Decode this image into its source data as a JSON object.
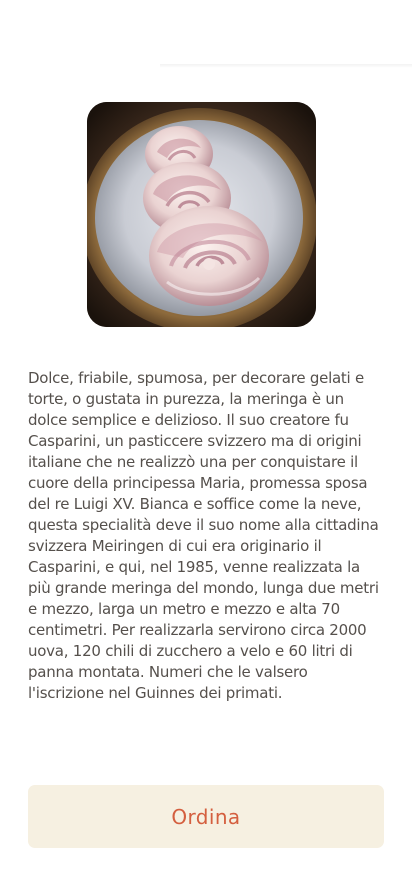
{
  "product": {
    "image_icon": "meringue-photo",
    "description": "Dolce, friabile, spumosa, per decorare gelati e torte, o gustata in purezza, la meringa è un dolce semplice e delizioso. Il suo creatore fu Casparini, un pasticcere svizzero ma di origini italiane che ne realizzò una per conquistare il cuore della principessa Maria, promessa sposa del re Luigi XV. Bianca e soffice come la neve, questa specialità deve il suo nome alla cittadina svizzera Meiringen di cui era originario il Casparini, e qui, nel 1985, venne realizzata la più grande meringa del mondo, lunga due metri e mezzo, larga un metro e mezzo e alta 70 centimetri. Per realizzarla servirono circa 2000 uova, 120 chili di zucchero a velo e 60 litri di panna montata. Numeri che le valsero l'iscrizione nel Guinnes dei primati."
  },
  "actions": {
    "order_label": "Ordina"
  },
  "colors": {
    "accent": "#d45f3f",
    "button_background": "#f6f0e1",
    "text": "#55504c"
  }
}
